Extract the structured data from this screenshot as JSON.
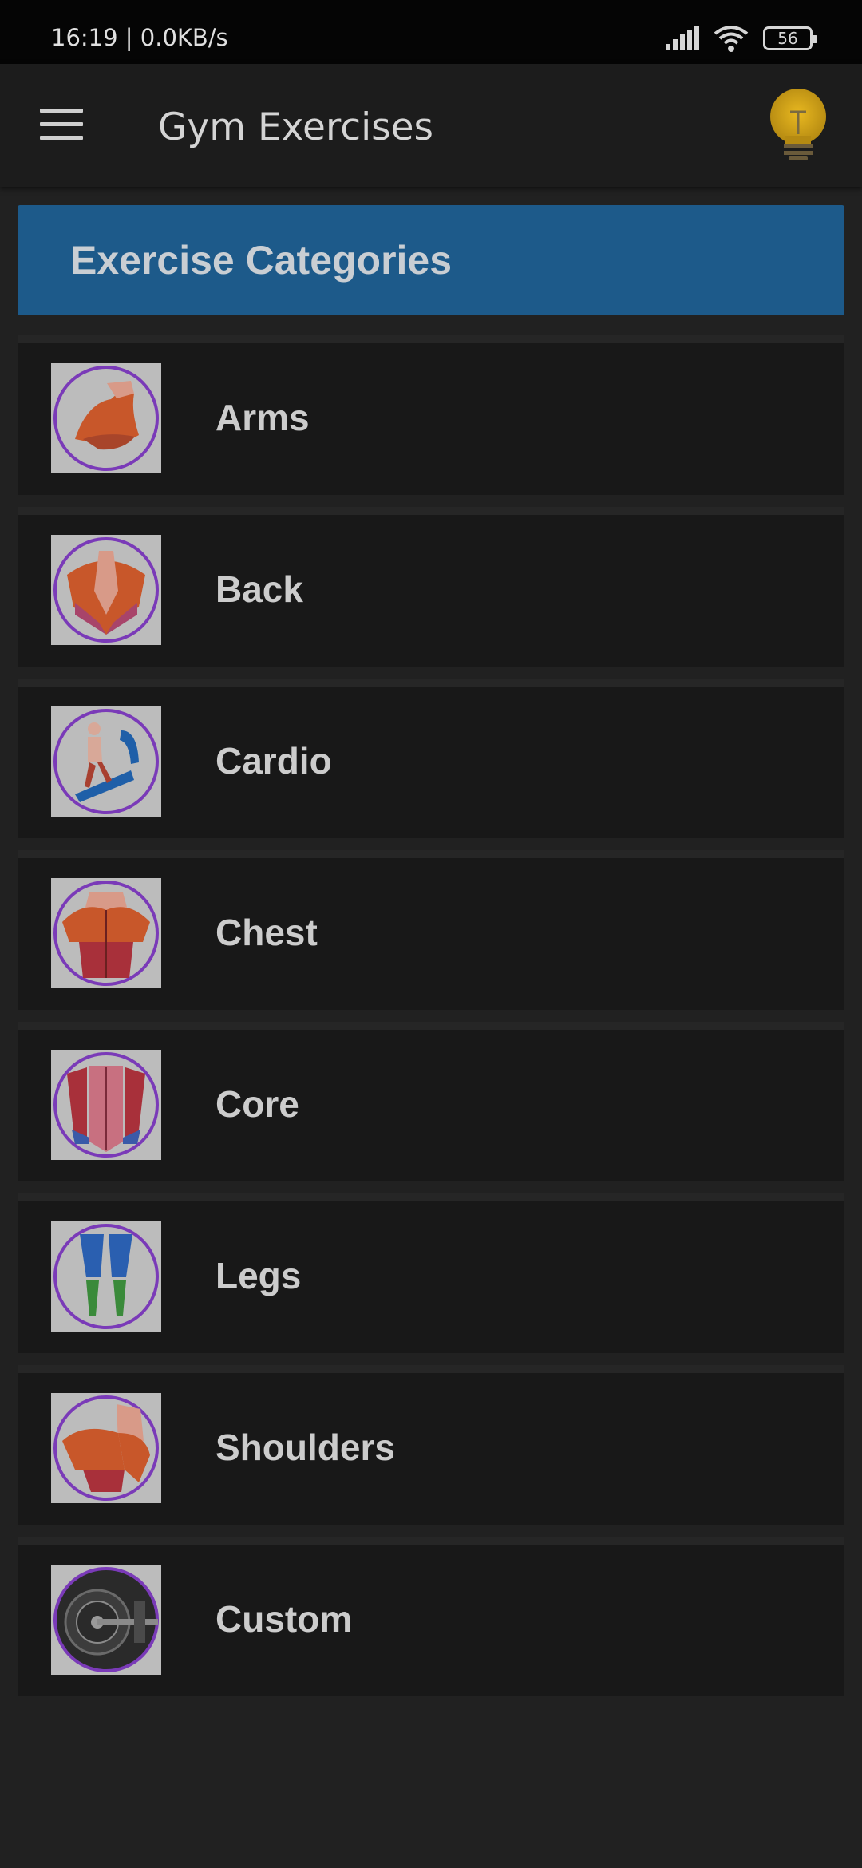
{
  "status_bar": {
    "time_network": "16:19 | 0.0KB/s",
    "battery_level": "56",
    "icons": [
      "signal-icon",
      "wifi-icon",
      "battery-icon"
    ]
  },
  "app_bar": {
    "title": "Gym Exercises",
    "menu_icon": "hamburger-menu-icon",
    "tip_icon": "lightbulb-icon"
  },
  "header": {
    "title": "Exercise Categories",
    "color": "#1d5a8a"
  },
  "categories": [
    {
      "label": "Arms",
      "icon": "arms-muscle-icon"
    },
    {
      "label": "Back",
      "icon": "back-muscle-icon"
    },
    {
      "label": "Cardio",
      "icon": "treadmill-runner-icon"
    },
    {
      "label": "Chest",
      "icon": "chest-muscle-icon"
    },
    {
      "label": "Core",
      "icon": "abs-muscle-icon"
    },
    {
      "label": "Legs",
      "icon": "legs-muscle-icon"
    },
    {
      "label": "Shoulders",
      "icon": "shoulder-muscle-icon"
    },
    {
      "label": "Custom",
      "icon": "weight-plates-icon"
    }
  ]
}
